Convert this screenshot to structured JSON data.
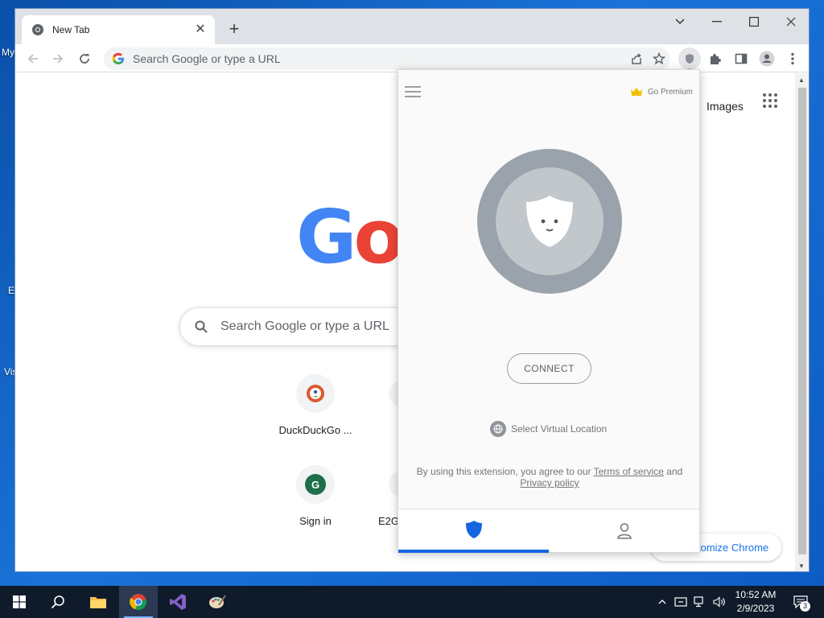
{
  "desktop": {
    "fragments": [
      "My",
      "E",
      "Vis"
    ]
  },
  "browser": {
    "tab": {
      "title": "New Tab"
    },
    "omnibox": {
      "placeholder": "Search Google or type a URL"
    }
  },
  "newtab_page": {
    "images_link": "Images",
    "logo_text": "Google",
    "search_placeholder": "Search Google or type a URL",
    "shortcuts": [
      {
        "label": "DuckDuckGo ...",
        "icon": "duckduckgo-icon"
      },
      {
        "label": "Sign in",
        "icon_letter": "G"
      },
      {
        "label": "E2G"
      }
    ],
    "customize_label": "Customize Chrome",
    "customize_visible": "tomize Chrome"
  },
  "vpn_popup": {
    "premium_label": "Go Premium",
    "connect_label": "CONNECT",
    "virtual_location_label": "Select Virtual Location",
    "terms_prefix": "By using this extension, you agree to our ",
    "terms_link": "Terms of service",
    "terms_and": " and",
    "privacy_link": "Privacy policy",
    "nav_active": "shield",
    "colors": {
      "accent": "#1565e0",
      "circle_outer": "#9aa2ab",
      "circle_inner": "#c2c7cc"
    }
  },
  "taskbar": {
    "time": "10:52 AM",
    "date": "2/9/2023",
    "notification_count": "3"
  }
}
